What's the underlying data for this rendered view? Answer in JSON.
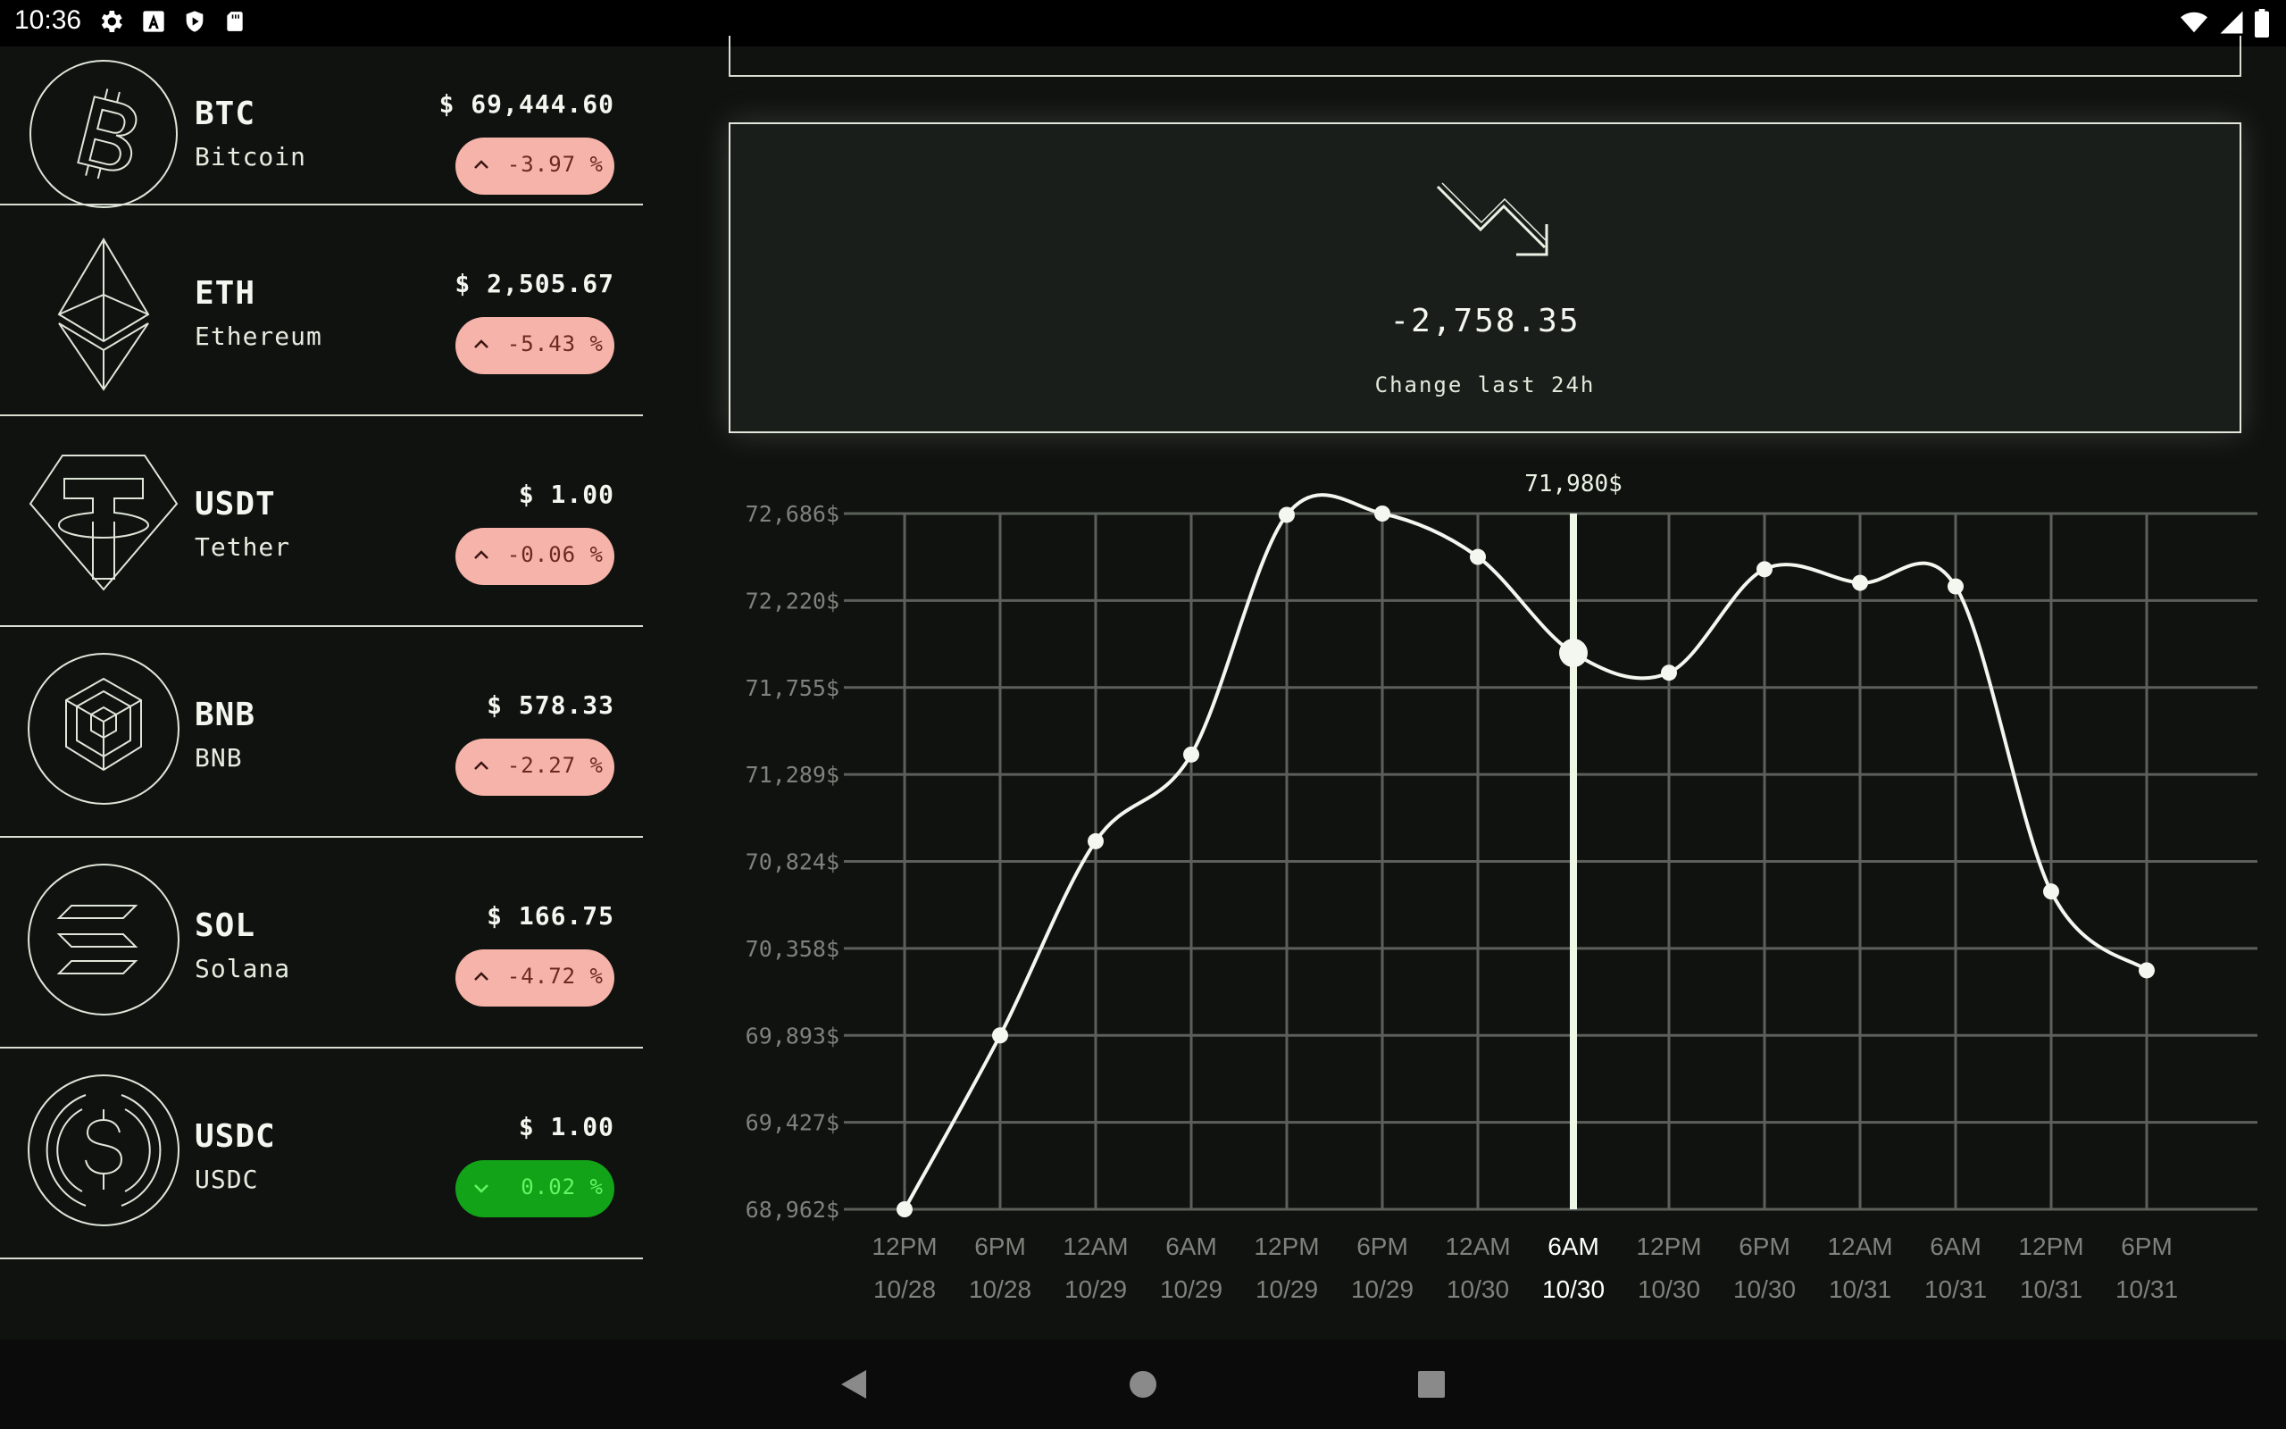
{
  "status_bar": {
    "time": "10:36",
    "left_icons": [
      "settings-icon",
      "app-a-icon",
      "shield-play-icon",
      "sd-card-icon"
    ],
    "right_icons": [
      "wifi-icon",
      "signal-icon",
      "battery-icon"
    ]
  },
  "coins": [
    {
      "symbol": "BTC",
      "name": "Bitcoin",
      "price": "$ 69,444.60",
      "change": "-3.97 %",
      "direction": "down",
      "icon": "bitcoin-icon"
    },
    {
      "symbol": "ETH",
      "name": "Ethereum",
      "price": "$ 2,505.67",
      "change": "-5.43 %",
      "direction": "down",
      "icon": "ethereum-icon"
    },
    {
      "symbol": "USDT",
      "name": "Tether",
      "price": "$ 1.00",
      "change": "-0.06 %",
      "direction": "down",
      "icon": "tether-icon"
    },
    {
      "symbol": "BNB",
      "name": "BNB",
      "price": "$ 578.33",
      "change": "-2.27 %",
      "direction": "down",
      "icon": "bnb-icon"
    },
    {
      "symbol": "SOL",
      "name": "Solana",
      "price": "$ 166.75",
      "change": "-4.72 %",
      "direction": "down",
      "icon": "solana-icon"
    },
    {
      "symbol": "USDC",
      "name": "USDC",
      "price": "$ 1.00",
      "change": "0.02 %",
      "direction": "up",
      "icon": "usdc-icon"
    }
  ],
  "summary": {
    "icon": "trending-down-icon",
    "value": "-2,758.35",
    "caption": "Change last 24h"
  },
  "colors": {
    "background": "#0f120f",
    "foreground": "#eaf2e4",
    "negative_pill": "#f6b3a9",
    "positive_pill": "#13a319",
    "grid": "#5c605a"
  },
  "chart_data": {
    "type": "line",
    "x_times": [
      "12PM",
      "6PM",
      "12AM",
      "6AM",
      "12PM",
      "6PM",
      "12AM",
      "6AM",
      "12PM",
      "6PM",
      "12AM",
      "6AM",
      "12PM",
      "6PM"
    ],
    "x_dates": [
      "10/28",
      "10/28",
      "10/29",
      "10/29",
      "10/29",
      "10/29",
      "10/30",
      "10/30",
      "10/30",
      "10/30",
      "10/31",
      "10/31",
      "10/31",
      "10/31"
    ],
    "y_ticks": [
      "72,686$",
      "72,220$",
      "71,755$",
      "71,289$",
      "70,824$",
      "70,358$",
      "69,893$",
      "69,427$",
      "68,962$"
    ],
    "ylim": [
      68962,
      72686
    ],
    "values": [
      68962,
      69893,
      70932,
      71396,
      72679,
      72686,
      72454,
      71940,
      71834,
      72388,
      72315,
      72296,
      70663,
      70241
    ],
    "selected_index": 7,
    "selected_label": "71,980$",
    "grid": true
  }
}
